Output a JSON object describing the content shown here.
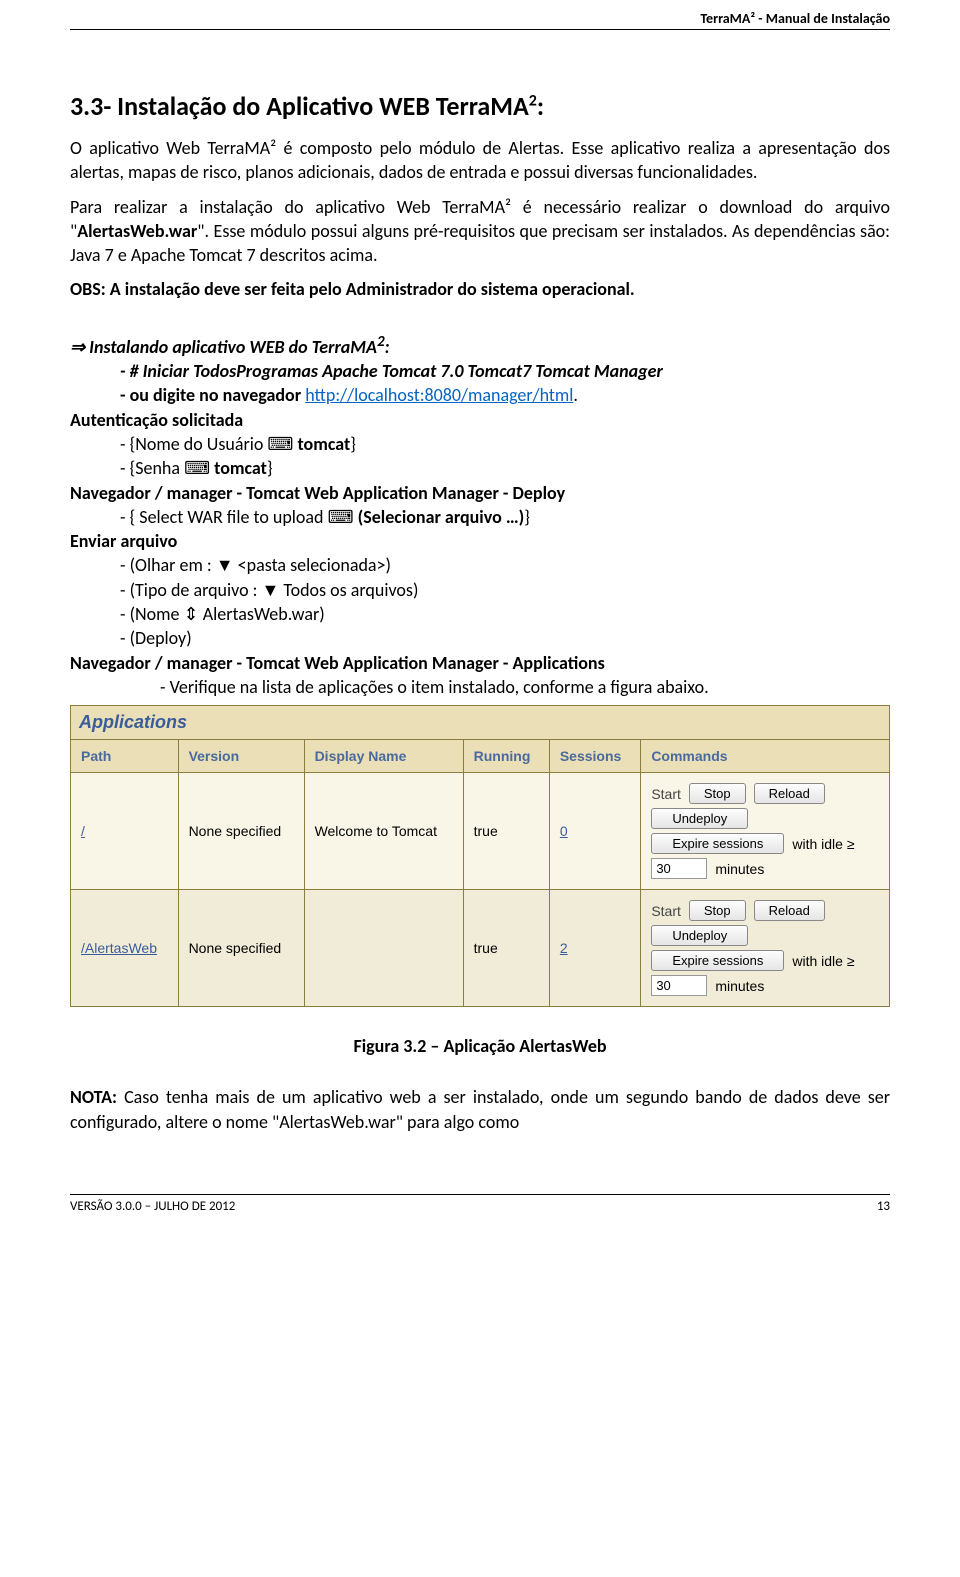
{
  "header": {
    "title": "TerraMA² - Manual de Instalação"
  },
  "section": {
    "number": "3.3",
    "title_prefix": "- Instalação do Aplicativo WEB TerraMA",
    "sup": "2",
    "colon": ":"
  },
  "p1": "O aplicativo Web TerraMA² é composto pelo módulo de Alertas. Esse aplicativo realiza a apresentação dos alertas, mapas de risco, planos adicionais, dados de entrada e possui diversas funcionalidades.",
  "p2_a": "Para realizar a instalação do aplicativo Web TerraMA² é necessário realizar o download do arquivo \"",
  "p2_b": "AlertasWeb.war",
  "p2_c": "\". Esse módulo possui alguns pré-requisitos que precisam ser instalados. As dependências são: Java 7 e Apache Tomcat 7 descritos acima.",
  "p3": "OBS: A instalação deve ser feita pelo Administrador do sistema operacional.",
  "install": {
    "heading": "Instalando aplicativo WEB do TerraMA",
    "sup": "2",
    "colon": ":",
    "l1": "- # Iniciar TodosProgramas Apache Tomcat 7.0 Tomcat7 Tomcat Manager",
    "l2a": "- ou digite no navegador ",
    "l2b": "http://localhost:8080/manager/html",
    "l2c": ".",
    "auth": "Autenticação solicitada",
    "l3a": "- {Nome do Usuário ⌨ ",
    "l3b": "tomcat",
    "l3c": "}",
    "l4a": "- {Senha ⌨ ",
    "l4b": "tomcat",
    "l4c": "}",
    "navdep": "Navegador / manager  - Tomcat Web Application Manager - Deploy",
    "l5a": "- { Select WAR file to upload ⌨ ",
    "l5b": "(Selecionar arquivo …)",
    "l5c": "}",
    "enviar": "Enviar arquivo",
    "l6": "- (Olhar em : ▼ <pasta selecionada>)",
    "l7": "- (Tipo de arquivo : ▼ Todos os arquivos)",
    "l8": "- (Nome ⇕ AlertasWeb.war)",
    "l9": "- (Deploy)",
    "navapp": "Navegador / manager  - Tomcat Web Application Manager - Applications",
    "l10": "- Verifique na lista de aplicações o item instalado, conforme a figura abaixo."
  },
  "table": {
    "caption": "Applications",
    "headers": [
      "Path",
      "Version",
      "Display Name",
      "Running",
      "Sessions",
      "Commands"
    ],
    "buttons": {
      "start": "Start",
      "stop": "Stop",
      "reload": "Reload",
      "undeploy": "Undeploy",
      "expire": "Expire sessions"
    },
    "idle_label_a": "with idle ≥",
    "idle_label_b": "minutes",
    "rows": [
      {
        "path": "/",
        "version": "None specified",
        "display": "Welcome to Tomcat",
        "running": "true",
        "sessions": "0",
        "idle": "30"
      },
      {
        "path": "/AlertasWeb",
        "version": "None specified",
        "display": "",
        "running": "true",
        "sessions": "2",
        "idle": "30"
      }
    ]
  },
  "figure_caption": "Figura 3.2 – Aplicação AlertasWeb",
  "nota_label": "NOTA:",
  "nota_text": " Caso tenha mais de um aplicativo web a ser instalado, onde um segundo bando de dados deve ser configurado, altere o nome \"AlertasWeb.war\" para algo como",
  "footer": {
    "left": "VERSÃO 3.0.0 – JULHO DE 2012",
    "right": "13"
  }
}
